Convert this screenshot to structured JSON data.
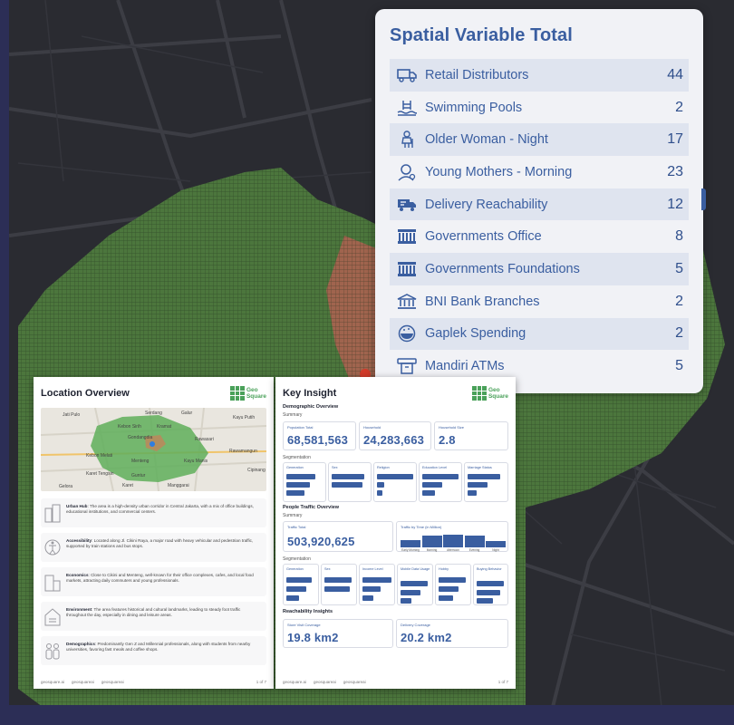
{
  "spatial_variable_card": {
    "title": "Spatial Variable Total",
    "items": [
      {
        "icon": "truck-icon",
        "label": "Retail Distributors",
        "value": "44"
      },
      {
        "icon": "swimming-pool-icon",
        "label": "Swimming Pools",
        "value": "2"
      },
      {
        "icon": "older-woman-icon",
        "label": "Older Woman - Night",
        "value": "17"
      },
      {
        "icon": "young-mother-icon",
        "label": "Young Mothers - Morning",
        "value": "23"
      },
      {
        "icon": "delivery-truck-icon",
        "label": "Delivery Reachability",
        "value": "12"
      },
      {
        "icon": "government-building-icon",
        "label": "Governments Office",
        "value": "8"
      },
      {
        "icon": "government-building-icon",
        "label": "Governments Foundations",
        "value": "5"
      },
      {
        "icon": "bank-icon",
        "label": "BNI Bank Branches",
        "value": "2"
      },
      {
        "icon": "food-bowl-icon",
        "label": "Gaplek Spending",
        "value": "2"
      },
      {
        "icon": "atm-icon",
        "label": "Mandiri ATMs",
        "value": "5"
      }
    ]
  },
  "logo": {
    "line1": "Geo",
    "line2": "Square"
  },
  "location_overview": {
    "title": "Location Overview",
    "map_labels": [
      "Jati Pulo",
      "Serdang",
      "Galur",
      "Kayu Putih",
      "Kebon Sirih",
      "Kramat",
      "Gondangdia",
      "Rawasari",
      "Kebon Melati",
      "Menteng",
      "Rawamangun",
      "Kayu Manis",
      "Karet Tengsin",
      "Guntur",
      "Gelora",
      "Karet",
      "Manggarai",
      "Cipinang"
    ],
    "cards": [
      {
        "icon": "city-icon",
        "title": "Urban Hub",
        "text": ": The area is a high-density urban corridor in Central Jakarta, with a mix of office buildings, educational institutions, and commercial centers."
      },
      {
        "icon": "accessibility-icon",
        "title": "Accessibility",
        "text": ": Located along Jl. Cikini Raya, a major road with heavy vehicular and pedestrian traffic, supported by train stations and bus stops."
      },
      {
        "icon": "economics-icon",
        "title": "Economics",
        "text": ": Close to Cikini and Menteng, well-known for their office complexes, cafes, and local food markets, attracting daily commuters and young professionals."
      },
      {
        "icon": "environment-icon",
        "title": "Environment",
        "text": ": The area features historical and cultural landmarks, leading to steady foot traffic throughout the day, especially in dining and leisure areas."
      },
      {
        "icon": "demographics-icon",
        "title": "Demographics",
        "text": ": Predominantly Gen Z and Millennial professionals, along with students from nearby universities, favoring fast meals and coffee shops."
      }
    ],
    "footer": {
      "site": "geosquare.ai",
      "ig": "geosquareai",
      "tw": "geosquareai",
      "page": "1 of 7"
    }
  },
  "key_insight": {
    "title": "Key Insight",
    "demographic_overview": "Demographic Overview",
    "summary_label": "Summary",
    "stats": [
      {
        "label": "Population Total",
        "value": "68,581,563"
      },
      {
        "label": "Household",
        "value": "24,283,663"
      },
      {
        "label": "Household Size",
        "value": "2.8"
      }
    ],
    "segmentation_label": "Segmentation",
    "segments": [
      "Generation",
      "Sex",
      "Religion",
      "Education Level",
      "Marriage Status"
    ],
    "people_traffic": "People Traffic Overview",
    "traffic_label": "Traffic Total",
    "traffic_value": "503,920,625",
    "traffic_time_label": "Traffic by Time (in Million)",
    "traffic_times": [
      "Early Morning",
      "Morning",
      "Afternoon",
      "Evening",
      "Night"
    ],
    "traffic_values": [
      28,
      42,
      47,
      44,
      22
    ],
    "segments2": [
      "Generation",
      "Sex",
      "Income Level",
      "Mobile Data Usage",
      "Hobby",
      "Buying Behavior"
    ],
    "reachability": "Reachability Insights",
    "reach": [
      {
        "label": "Store Visit Coverage",
        "value": "19.8 km2"
      },
      {
        "label": "Delivery Coverage",
        "value": "20.2 km2"
      }
    ],
    "footer": {
      "site": "geosquare.ai",
      "ig": "geosquareai",
      "tw": "geosquareai",
      "page": "1 of 7"
    }
  },
  "colors": {
    "accent": "#3a5ea0",
    "map_green": "#4e7a3e",
    "map_red": "#a4634f",
    "background": "#2c2e56"
  }
}
